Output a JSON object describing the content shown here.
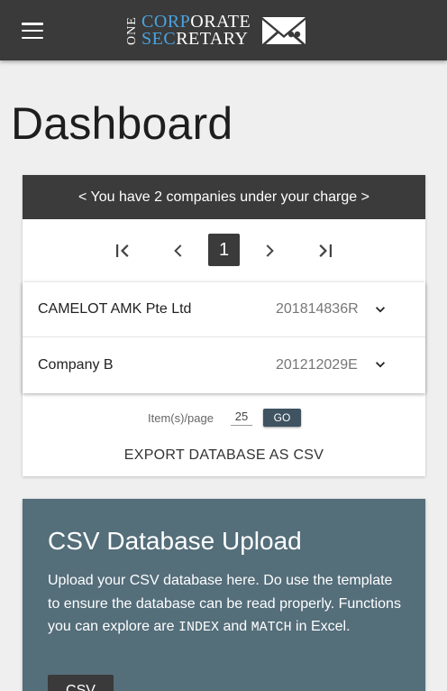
{
  "header": {
    "logo": {
      "one": "ONE",
      "corp_blue": "CORP",
      "corp_white": "ORATE",
      "sec_blue": "SEC",
      "sec_white": "RETARY"
    }
  },
  "page": {
    "title": "Dashboard"
  },
  "companies_card": {
    "header_text": "< You have 2 companies under your charge >",
    "pagination": {
      "current_page": "1"
    },
    "rows": [
      {
        "name": "CAMELOT AMK Pte Ltd",
        "uen": "201814836R"
      },
      {
        "name": "Company B",
        "uen": "201212029E"
      }
    ],
    "items_per_page_label": "Item(s)/page",
    "items_per_page_value": "25",
    "go_label": "GO",
    "export_label": "EXPORT DATABASE AS CSV"
  },
  "upload_card": {
    "title": "CSV Database Upload",
    "desc_part1": "Upload your CSV database here. Do use the template to ensure the database can be read properly. Functions you can explore are ",
    "code1": "INDEX",
    "desc_and": " and ",
    "code2": "MATCH",
    "desc_part2": " in Excel.",
    "button_label": "CSV"
  },
  "colors": {
    "topbar": "#3a3a3a",
    "logo_accent": "#4aa3df",
    "card_header": "#3b3b3b",
    "upload_card": "#546e7a",
    "go_button": "#3f5361"
  },
  "icons": [
    "menu-icon",
    "envelope-logo-icon",
    "first-page-icon",
    "prev-page-icon",
    "next-page-icon",
    "last-page-icon",
    "chevron-down-icon"
  ]
}
